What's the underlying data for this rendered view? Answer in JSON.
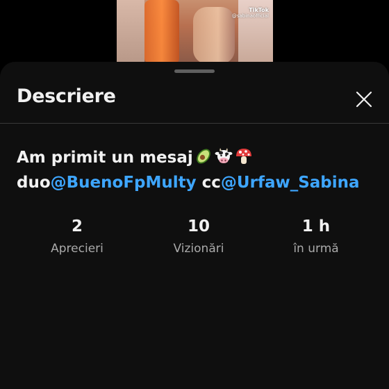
{
  "video": {
    "watermark_brand": "TikTok",
    "watermark_handle": "@sabinaofficial"
  },
  "sheet": {
    "title": "Descriere"
  },
  "description": {
    "line1_text": "Am primit un mesaj",
    "emojis": [
      "avocado-icon",
      "cow-face-icon",
      "mushroom-icon"
    ],
    "line2_prefix": "duo",
    "mention1": "@BuenoFpMulty",
    "line2_middle": " cc",
    "mention2": "@Urfaw_Sabina"
  },
  "stats": [
    {
      "value": "2",
      "label": "Aprecieri"
    },
    {
      "value": "10",
      "label": "Vizionări"
    },
    {
      "value": "1 h",
      "label": "în urmă"
    }
  ],
  "colors": {
    "sheet_bg": "#0f0f0f",
    "mention": "#3ea6ff",
    "text_primary": "#f1f1f1",
    "text_secondary": "#aaaaaa"
  }
}
